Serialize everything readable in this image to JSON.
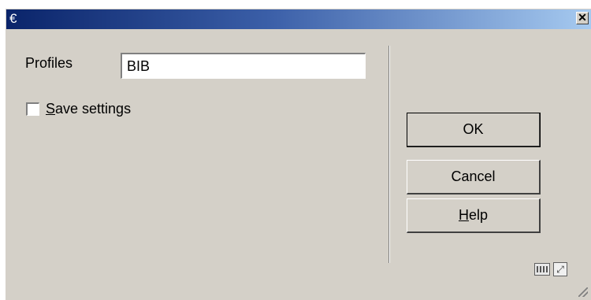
{
  "window": {
    "title": "€",
    "close_glyph": "✕"
  },
  "form": {
    "profiles_label": "Profiles",
    "profiles_value": "BIB",
    "save_settings_label_accel": "S",
    "save_settings_label_rest": "ave settings",
    "save_settings_checked": false
  },
  "buttons": {
    "ok_label": "OK",
    "cancel_label": "Cancel",
    "help_accel": "H",
    "help_rest": "elp"
  },
  "status": {
    "maximize_glyph": "⤢"
  },
  "colors": {
    "face": "#d4d0c8",
    "title_start": "#0a246a",
    "title_end": "#a6caf0"
  }
}
